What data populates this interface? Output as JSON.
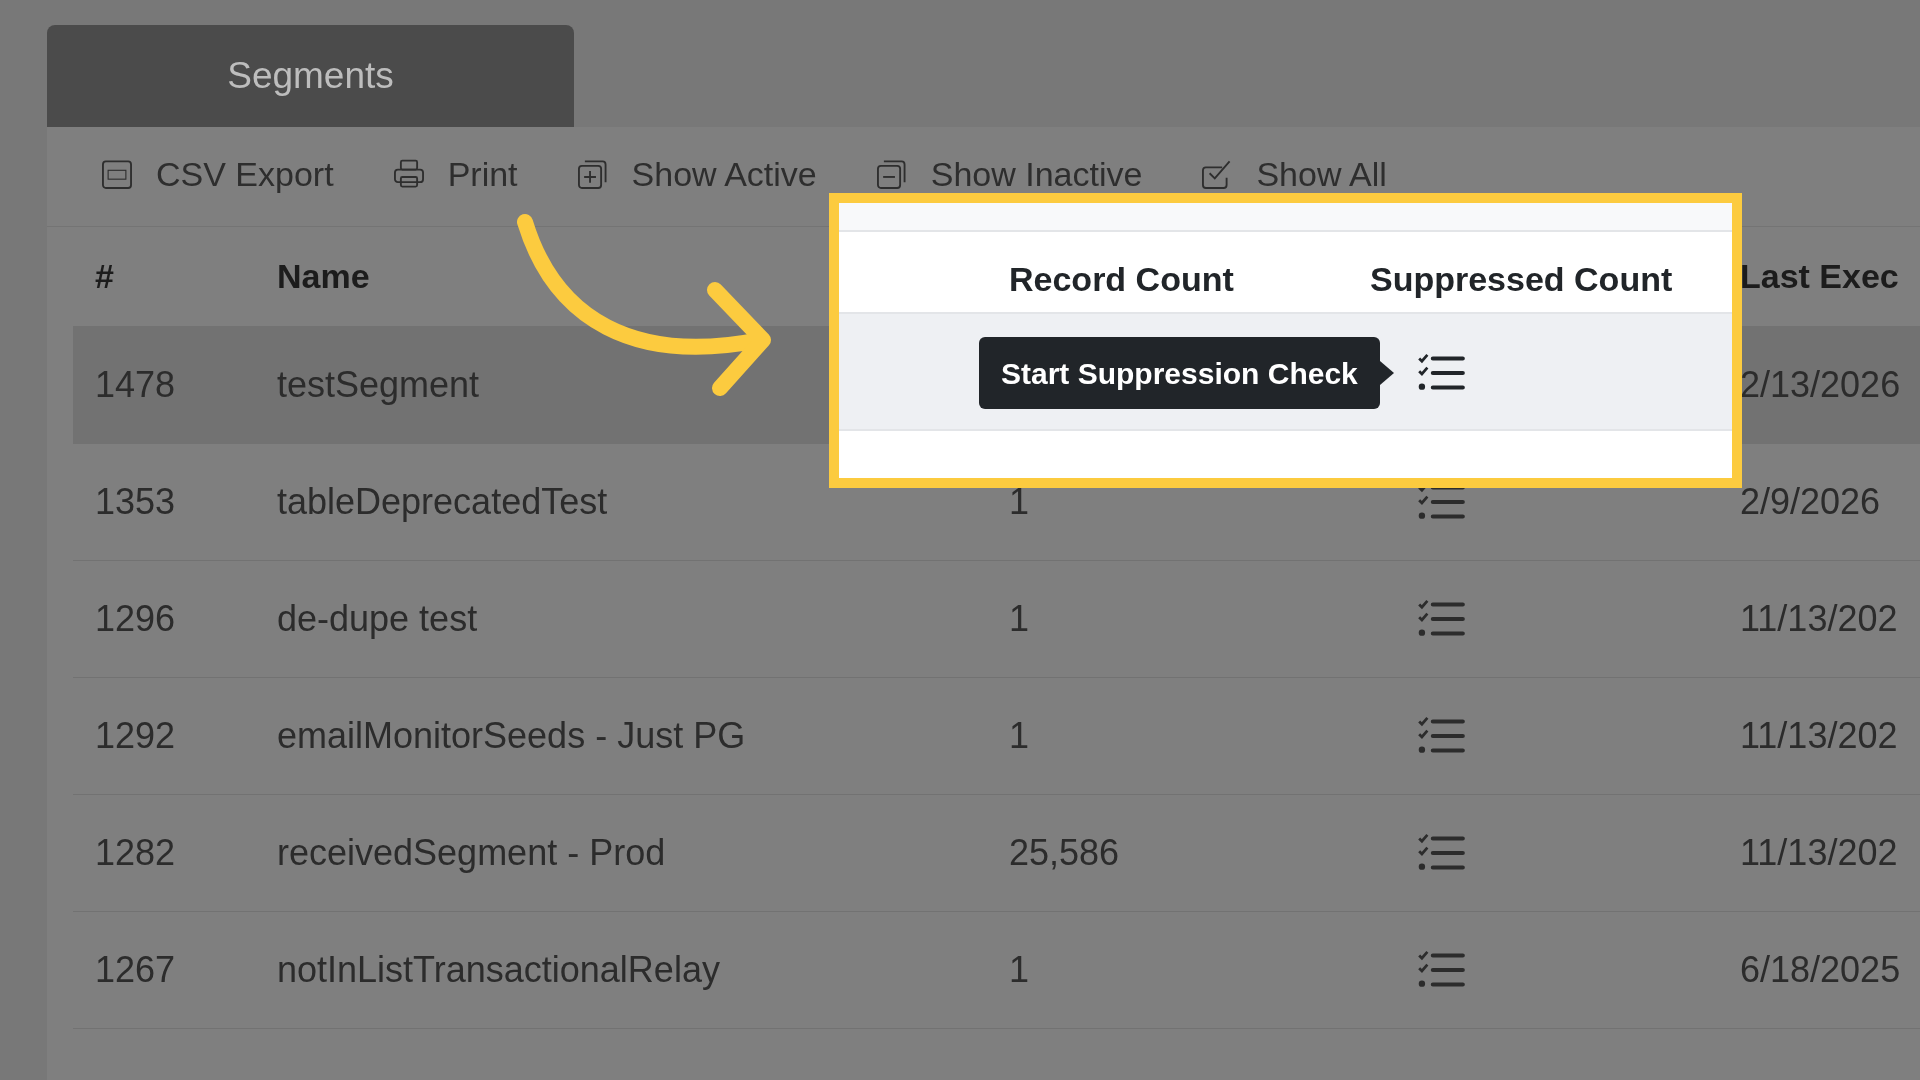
{
  "tab": {
    "label": "Segments",
    "selected": true
  },
  "toolbar": [
    {
      "label": "CSV Export",
      "kind": "csv"
    },
    {
      "label": "Print",
      "kind": "print"
    },
    {
      "label": "Show Active",
      "kind": "active"
    },
    {
      "label": "Show Inactive",
      "kind": "inactive"
    },
    {
      "label": "Show All",
      "kind": "all"
    }
  ],
  "table": {
    "columns": [
      "#",
      "Name",
      "Last Exec"
    ],
    "rows": [
      {
        "id": "1478",
        "name": "testSegment",
        "date": "2/13/2026",
        "highlighted": true
      },
      {
        "id": "1353",
        "name": "tableDeprecatedTest",
        "record_count": "1",
        "date": "2/9/2026",
        "highlighted": false
      },
      {
        "id": "1296",
        "name": "de-dupe test",
        "record_count": "1",
        "date": "11/13/202",
        "highlighted": false
      },
      {
        "id": "1292",
        "name": "emailMonitorSeeds - Just PG",
        "record_count": "1",
        "date": "11/13/202",
        "highlighted": false
      },
      {
        "id": "1282",
        "name": "receivedSegment - Prod",
        "record_count": "25,586",
        "date": "11/13/202",
        "highlighted": false
      },
      {
        "id": "1267",
        "name": "notInListTransactionalRelay",
        "record_count": "1",
        "date": "6/18/2025",
        "highlighted": false
      }
    ]
  },
  "spotlight": {
    "columns": [
      "Record Count",
      "Suppressed Count"
    ],
    "tooltip": "Start Suppression Check"
  }
}
